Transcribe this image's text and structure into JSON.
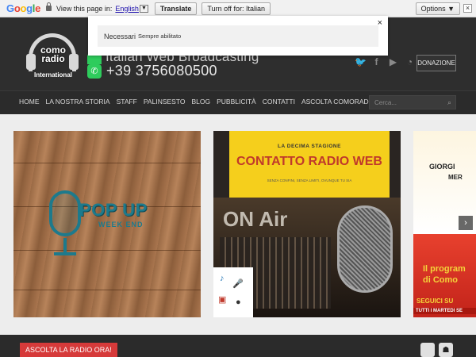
{
  "translate_bar": {
    "logo": "Google",
    "prompt": "View this page in:",
    "language": "English",
    "translate_label": "Translate",
    "turn_off_label": "Turn off for: Italian",
    "options_label": "Options ▼",
    "close": "×"
  },
  "header": {
    "logo_text": "como radio",
    "logo_sub": "International",
    "tagline": "Italian Web Broadcasting",
    "phone": "+39 3756080500",
    "donate_label": "DONAZIONE",
    "social_icons": [
      "twitter-icon",
      "facebook-icon",
      "youtube-icon",
      "rss-icon"
    ]
  },
  "nav": {
    "items": [
      "HOME",
      "LA NOSTRA STORIA",
      "STAFF",
      "PALINSESTO",
      "BLOG",
      "PUBBLICITÀ",
      "CONTATTI",
      "ASCOLTA COMORADIO!"
    ],
    "search_placeholder": "Cerca..."
  },
  "slides": {
    "card1": {
      "title": "POP UP",
      "subtitle": "WEEK END"
    },
    "card2": {
      "kicker": "LA DECIMA STAGIONE",
      "title": "CONTATTO RADIO WEB",
      "sub": "SENZA CONFINI, SENZA LIMITI, OVUNQUE TU SIA",
      "onair": "ON Air"
    },
    "card3": {
      "t1": "GIORGI",
      "t2": "MER",
      "t3": "Il program",
      "t4": "di Como",
      "t5": "SEGUICI SU",
      "t6": "TUTTI I MARTEDI SE"
    }
  },
  "footer": {
    "listen_label": "ASCOLTA LA RADIO ORA!"
  },
  "cookie": {
    "label": "Necessari",
    "status": "Sempre abilitato",
    "close": "×"
  },
  "colors": {
    "accent_red": "#d63a3a",
    "header_bg": "#2e2e2e",
    "whatsapp_green": "#2ecc5c"
  }
}
